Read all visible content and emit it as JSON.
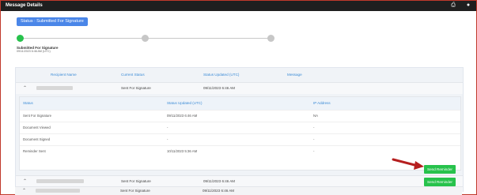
{
  "window": {
    "title": "Message Details",
    "icons": [
      "print-icon",
      "user-icon"
    ]
  },
  "status": {
    "label": "Status : Submitted For Signature"
  },
  "progress": {
    "step_title": "Submitted For Signature",
    "step_sub": "09/11/2023 6:46 AM (UTC)",
    "current_step": 1,
    "total_steps": 3
  },
  "table": {
    "headers": [
      "Recipient Name",
      "Current Status",
      "Status Updated (UTC)",
      "Message"
    ],
    "rows": [
      {
        "status": "Sent For Signature",
        "updated": "09/11/2023 6:46 AM",
        "expanded": true
      },
      {
        "status": "Sent For Signature",
        "updated": "09/11/2023 6:46 AM",
        "button": "Send Reminder"
      },
      {
        "status": "Sent For Signature",
        "updated": "09/11/2023 6:46 AM",
        "button": "Send Reminder"
      }
    ]
  },
  "detail": {
    "headers": [
      "Status",
      "Status Updated (UTC)",
      "IP Address"
    ],
    "rows": [
      {
        "status": "Sent For Signature",
        "updated": "09/11/2023 6:46 AM",
        "ip": "NA"
      },
      {
        "status": "Document Viewed",
        "updated": "-",
        "ip": "-"
      },
      {
        "status": "Document Signed",
        "updated": "-",
        "ip": "-"
      },
      {
        "status": "Reminder Sent",
        "updated": "10/11/2023 5:36 AM",
        "ip": "-"
      }
    ]
  },
  "colors": {
    "accent": "#4a86e8",
    "success": "#27c24c",
    "header_text": "#3b8bd6",
    "title_bar": "#1f1f1f"
  }
}
